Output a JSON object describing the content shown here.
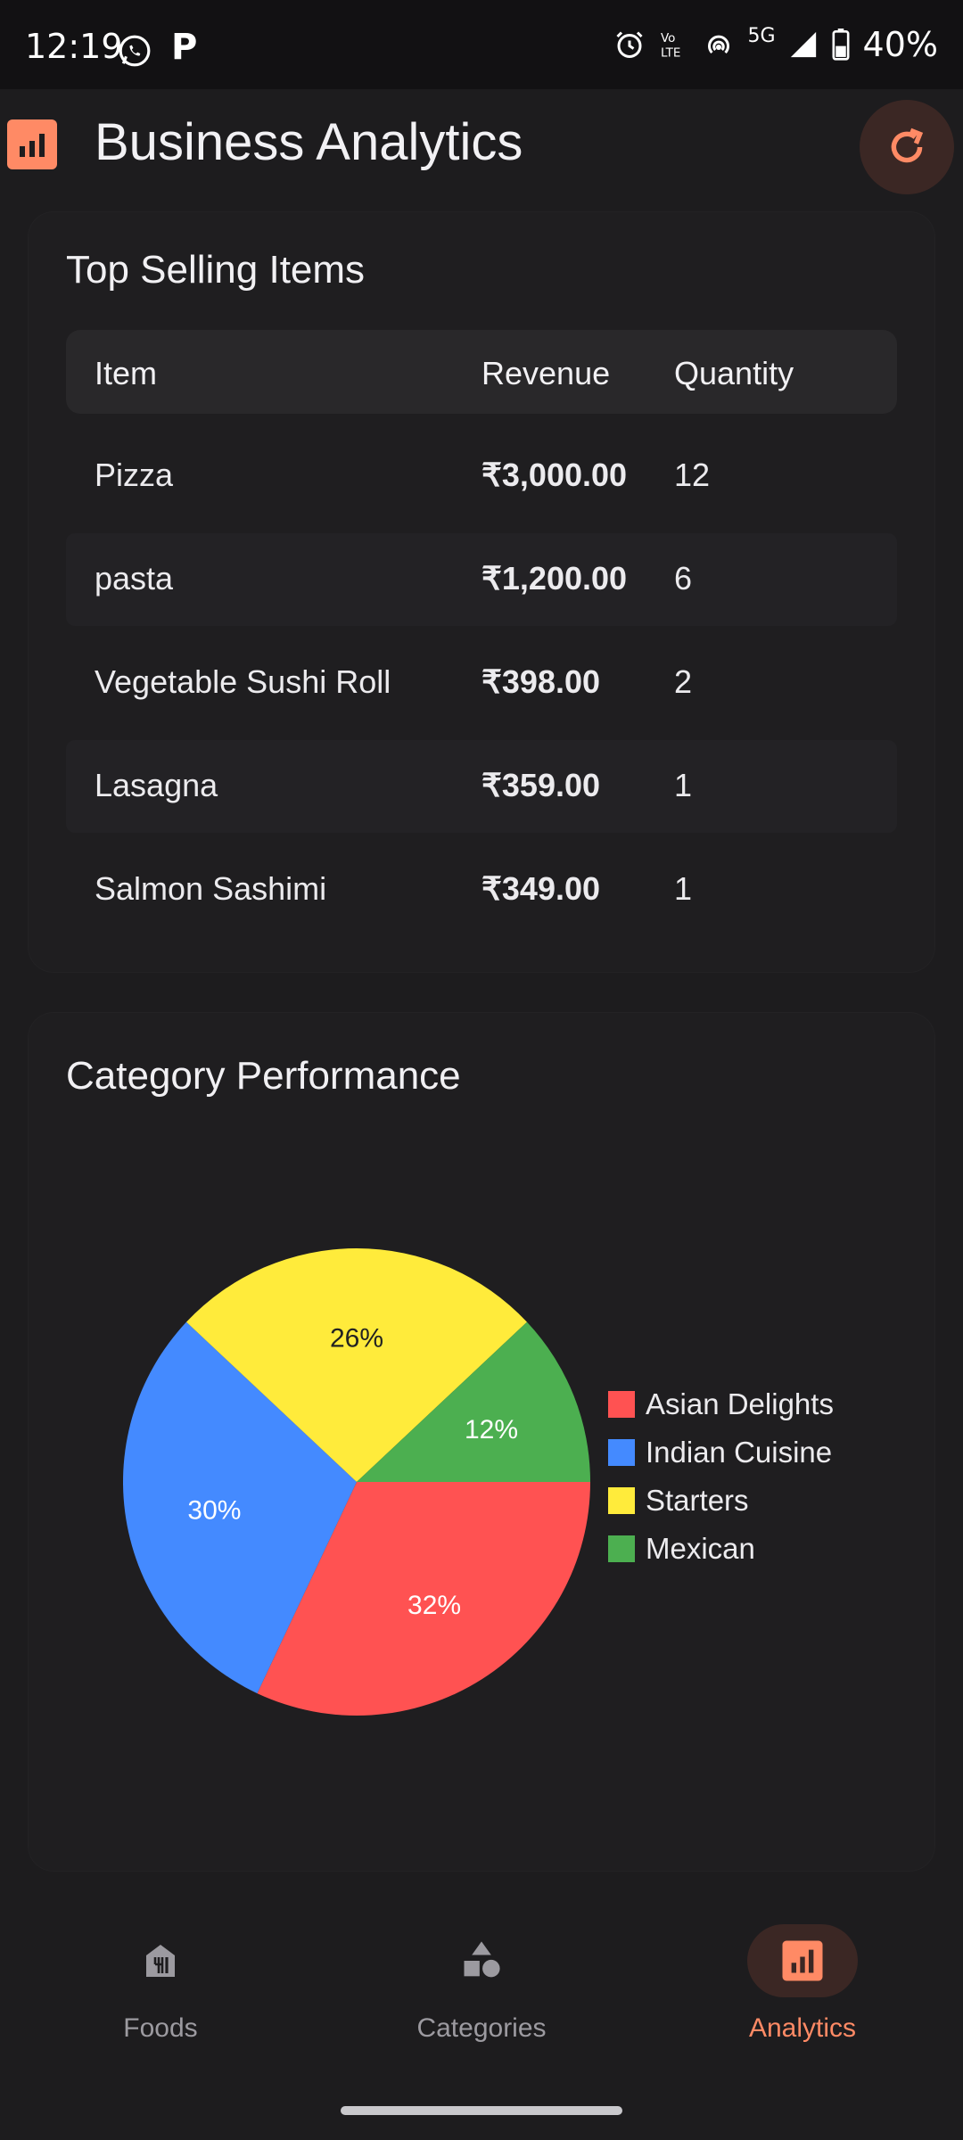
{
  "status_bar": {
    "time": "12:19",
    "p_letter": "P",
    "network": "5G",
    "battery": "40%"
  },
  "app_bar": {
    "title": "Business Analytics",
    "accent": "#ff8a65"
  },
  "top_selling": {
    "title": "Top Selling Items",
    "headers": {
      "item": "Item",
      "revenue": "Revenue",
      "quantity": "Quantity"
    },
    "rows": [
      {
        "item": "Pizza",
        "revenue": "₹3,000.00",
        "quantity": "12"
      },
      {
        "item": "pasta",
        "revenue": "₹1,200.00",
        "quantity": "6"
      },
      {
        "item": "Vegetable Sushi Roll",
        "revenue": "₹398.00",
        "quantity": "2"
      },
      {
        "item": "Lasagna",
        "revenue": "₹359.00",
        "quantity": "1"
      },
      {
        "item": "Salmon Sashimi",
        "revenue": "₹349.00",
        "quantity": "1"
      }
    ]
  },
  "category_performance": {
    "title": "Category Performance"
  },
  "chart_data": {
    "type": "pie",
    "categories": [
      "Asian Delights",
      "Indian Cuisine",
      "Starters",
      "Mexican"
    ],
    "values": [
      32,
      30,
      26,
      12
    ],
    "labels": [
      "32%",
      "30%",
      "26%",
      "12%"
    ],
    "colors": [
      "#ff5252",
      "#448aff",
      "#ffeb3b",
      "#4caf50"
    ],
    "legend_position": "right"
  },
  "bottom_nav": {
    "items": [
      {
        "label": "Foods",
        "icon": "food-icon"
      },
      {
        "label": "Categories",
        "icon": "categories-icon"
      },
      {
        "label": "Analytics",
        "icon": "analytics-icon"
      }
    ],
    "active_index": 2
  }
}
